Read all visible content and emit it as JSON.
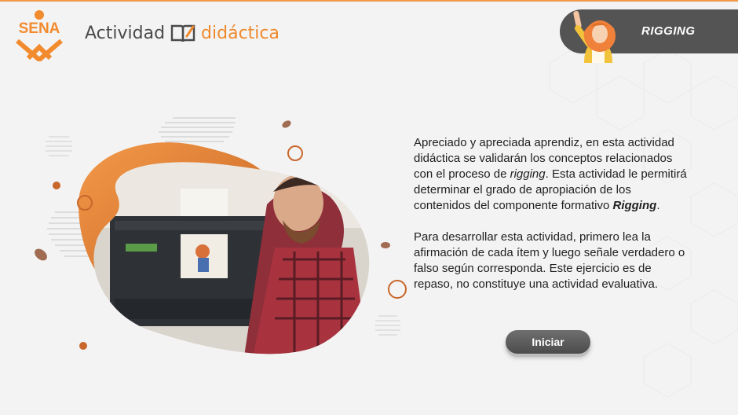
{
  "header": {
    "logo_text": "SENA",
    "activity_word": "Actividad",
    "didactica_word": "didáctica",
    "badge_label": "RIGGING"
  },
  "intro": {
    "p1_a": "Apreciado y apreciada aprendiz, en esta actividad didáctica se validarán los conceptos relacionados con el proceso de ",
    "p1_rigging": "rigging",
    "p1_b": ". Esta actividad le permitirá determinar el grado de apropiación de los contenidos del componente formativo ",
    "p1_rigging_bold": "Rigging",
    "p1_c": ".",
    "p2": "Para desarrollar esta actividad, primero lea la afirmación de cada ítem y luego señale verdadero o falso según corresponda. Este ejercicio es de repaso, no constituye una actividad evaluativa."
  },
  "start_button": {
    "label": "Iniciar"
  },
  "colors": {
    "accent_orange": "#ef8a2c",
    "badge_gray": "#545454",
    "text": "#1f1f1f"
  },
  "icons": [
    "sena-logo-icon",
    "book-icon",
    "avatar-girl-icon"
  ]
}
